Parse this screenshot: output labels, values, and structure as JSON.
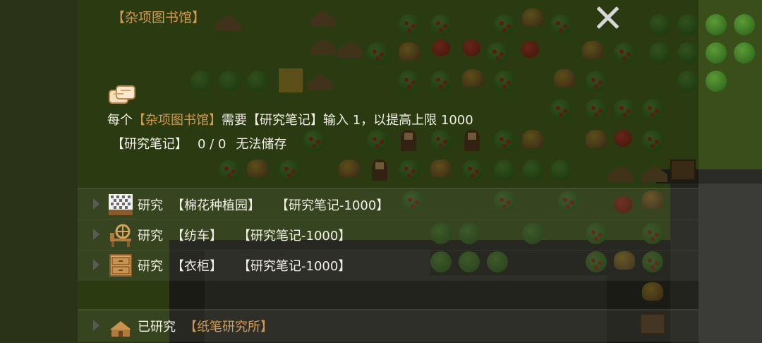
{
  "panel": {
    "title": "【杂项图书馆】",
    "description": {
      "prefix": "每个",
      "building": "【杂项图书馆】",
      "requires": "需要",
      "item": "【研究笔记】",
      "input_text": "输入 1，以提高上限 1000"
    },
    "storage": {
      "item": "【研究笔记】",
      "amount": "0 / 0",
      "status": "无法储存"
    }
  },
  "research_rows": [
    {
      "action": "研究",
      "target": "【棉花种植园】",
      "cost": "【研究笔记-1000】",
      "icon": "cotton-plantation-icon"
    },
    {
      "action": "研究",
      "target": "【纺车】",
      "cost": "【研究笔记-1000】",
      "icon": "spinning-wheel-icon"
    },
    {
      "action": "研究",
      "target": "【衣柜】",
      "cost": "【研究笔记-1000】",
      "icon": "wardrobe-icon"
    }
  ],
  "researched_row": {
    "action": "已研究",
    "target": "【纸笔研究所】",
    "icon": "paper-pen-institute-icon"
  },
  "colors": {
    "highlight": "#d69a4f",
    "text": "#f1efe6",
    "overlay": "rgba(12,14,6,0.52)"
  }
}
